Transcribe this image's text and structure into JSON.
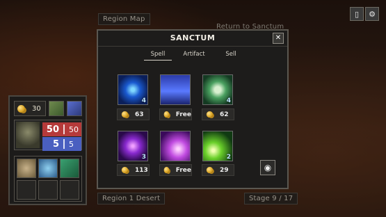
{
  "background": {
    "region_map_label": "Region Map",
    "return_label": "Return to Sanctum",
    "region_name": "Region 1 Desert",
    "stage_label": "Stage 9 / 17"
  },
  "top_buttons": [
    {
      "icon": "book-icon"
    },
    {
      "icon": "gear-icon"
    }
  ],
  "player": {
    "gold": "30",
    "hp_current": "50",
    "hp_max": "50",
    "mana_current": "5",
    "mana_max": "5",
    "hp_color": "#b53a3a",
    "mana_color": "#4a5fc0"
  },
  "modal": {
    "title": "SANCTUM",
    "tabs": [
      {
        "label": "Spell",
        "active": true
      },
      {
        "label": "Artifact",
        "active": false
      },
      {
        "label": "Sell",
        "active": false
      }
    ],
    "spells": [
      {
        "icon": "blue-eye-spell-icon",
        "level": "4",
        "price": "63"
      },
      {
        "icon": "sword-shield-spell-icon",
        "level": "",
        "price": "Free"
      },
      {
        "icon": "skull-spell-icon",
        "level": "4",
        "price": "62"
      },
      {
        "icon": "purple-rune-spell-icon",
        "level": "3",
        "price": "113"
      },
      {
        "icon": "purple-burst-spell-icon",
        "level": "",
        "price": "Free"
      },
      {
        "icon": "green-bolt-spell-icon",
        "level": "2",
        "price": "29"
      }
    ]
  }
}
